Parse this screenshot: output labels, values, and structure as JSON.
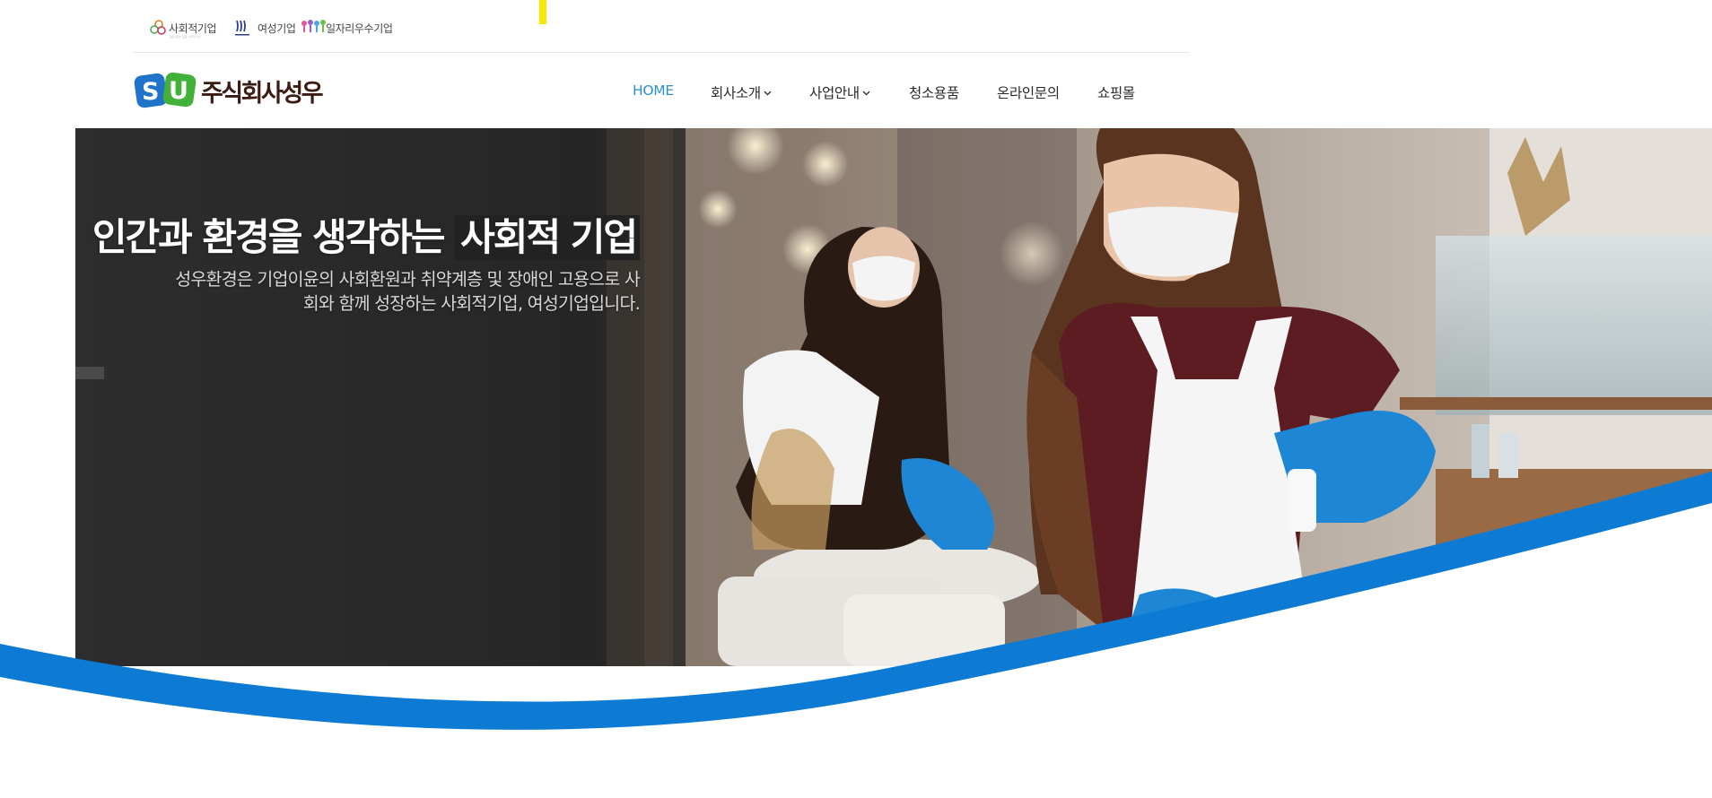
{
  "certifications": [
    {
      "label": "사회적기업",
      "icon": "social-enterprise-icon",
      "sub": "고용노동부 인증 사회적기업"
    },
    {
      "label": "여성기업",
      "icon": "women-enterprise-icon"
    },
    {
      "label": "일자리우수기업",
      "icon": "excellent-job-enterprise-icon"
    }
  ],
  "brand": {
    "logo_mark": "SU",
    "name": "주식회사성우",
    "colors": {
      "blue": "#1f74c9",
      "green": "#41b13a",
      "text": "#3a1c14"
    }
  },
  "nav": {
    "items": [
      {
        "label": "HOME",
        "active": true,
        "dropdown": false
      },
      {
        "label": "회사소개",
        "active": false,
        "dropdown": true
      },
      {
        "label": "사업안내",
        "active": false,
        "dropdown": true
      },
      {
        "label": "청소용품",
        "active": false,
        "dropdown": false
      },
      {
        "label": "온라인문의",
        "active": false,
        "dropdown": false
      },
      {
        "label": "쇼핑몰",
        "active": false,
        "dropdown": false
      }
    ],
    "active_color": "#2b8fd0"
  },
  "hero": {
    "headline_prefix": "인간과 환경을 생각하는",
    "headline_highlight": "사회적 기업",
    "description_line1": "성우환경은 기업이윤의 사회환원과 취약계층 및 장애인 고용으로 사",
    "description_line2": "회와 함께 성장하는 사회적기업, 여성기업입니다.",
    "wave_color": "#0d7ad4"
  }
}
